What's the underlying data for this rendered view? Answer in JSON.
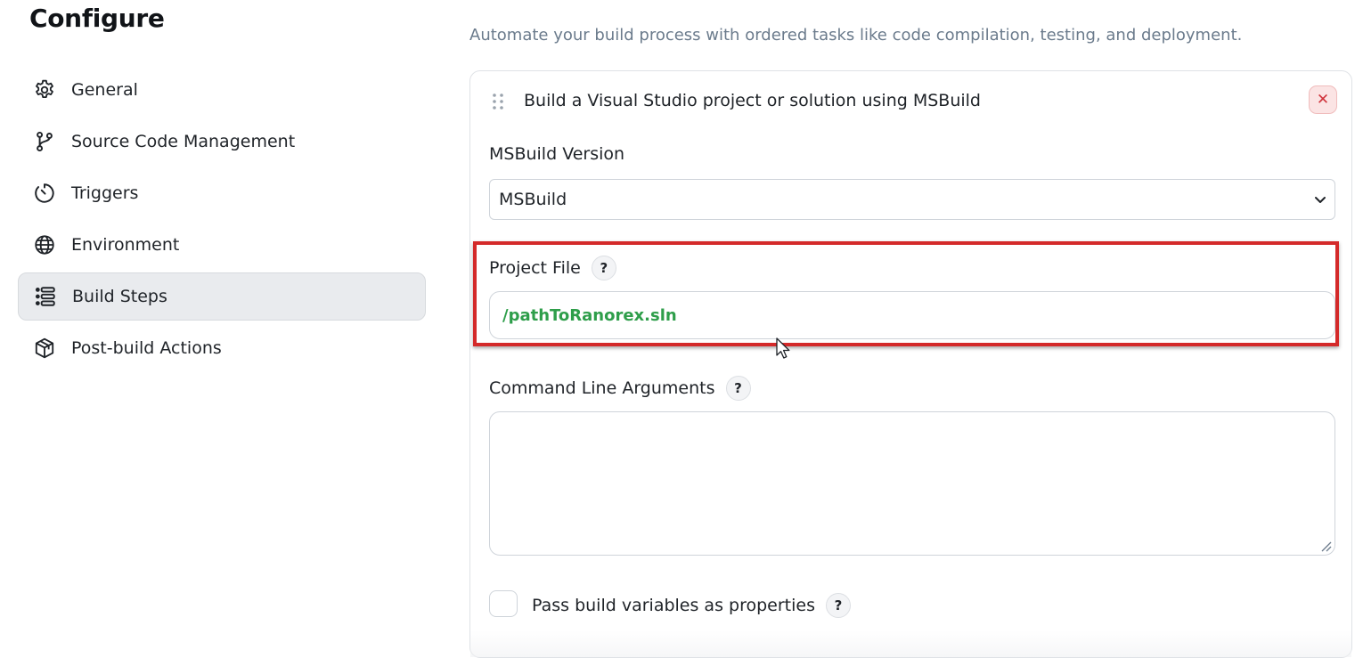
{
  "page": {
    "title": "Configure"
  },
  "sidebar": {
    "items": [
      {
        "label": "General",
        "icon": "gear-icon",
        "active": false
      },
      {
        "label": "Source Code Management",
        "icon": "branch-icon",
        "active": false
      },
      {
        "label": "Triggers",
        "icon": "clock-icon",
        "active": false
      },
      {
        "label": "Environment",
        "icon": "globe-icon",
        "active": false
      },
      {
        "label": "Build Steps",
        "icon": "list-icon",
        "active": true
      },
      {
        "label": "Post-build Actions",
        "icon": "package-icon",
        "active": false
      }
    ]
  },
  "main": {
    "description": "Automate your build process with ordered tasks like code compilation, testing, and deployment.",
    "build_step": {
      "title": "Build a Visual Studio project or solution using MSBuild",
      "close_symbol": "✕",
      "msbuild_version": {
        "label": "MSBuild Version",
        "value": "MSBuild"
      },
      "project_file": {
        "label": "Project File",
        "help": "?",
        "value": "/pathToRanorex.sln"
      },
      "command_line_arguments": {
        "label": "Command Line Arguments",
        "help": "?",
        "value": ""
      },
      "pass_build_variables": {
        "label": "Pass build variables as properties",
        "help": "?",
        "checked": false
      }
    }
  },
  "colors": {
    "highlight": "#d42a2a",
    "accent_green": "#2e9e4a",
    "close_red": "#d0343c"
  }
}
